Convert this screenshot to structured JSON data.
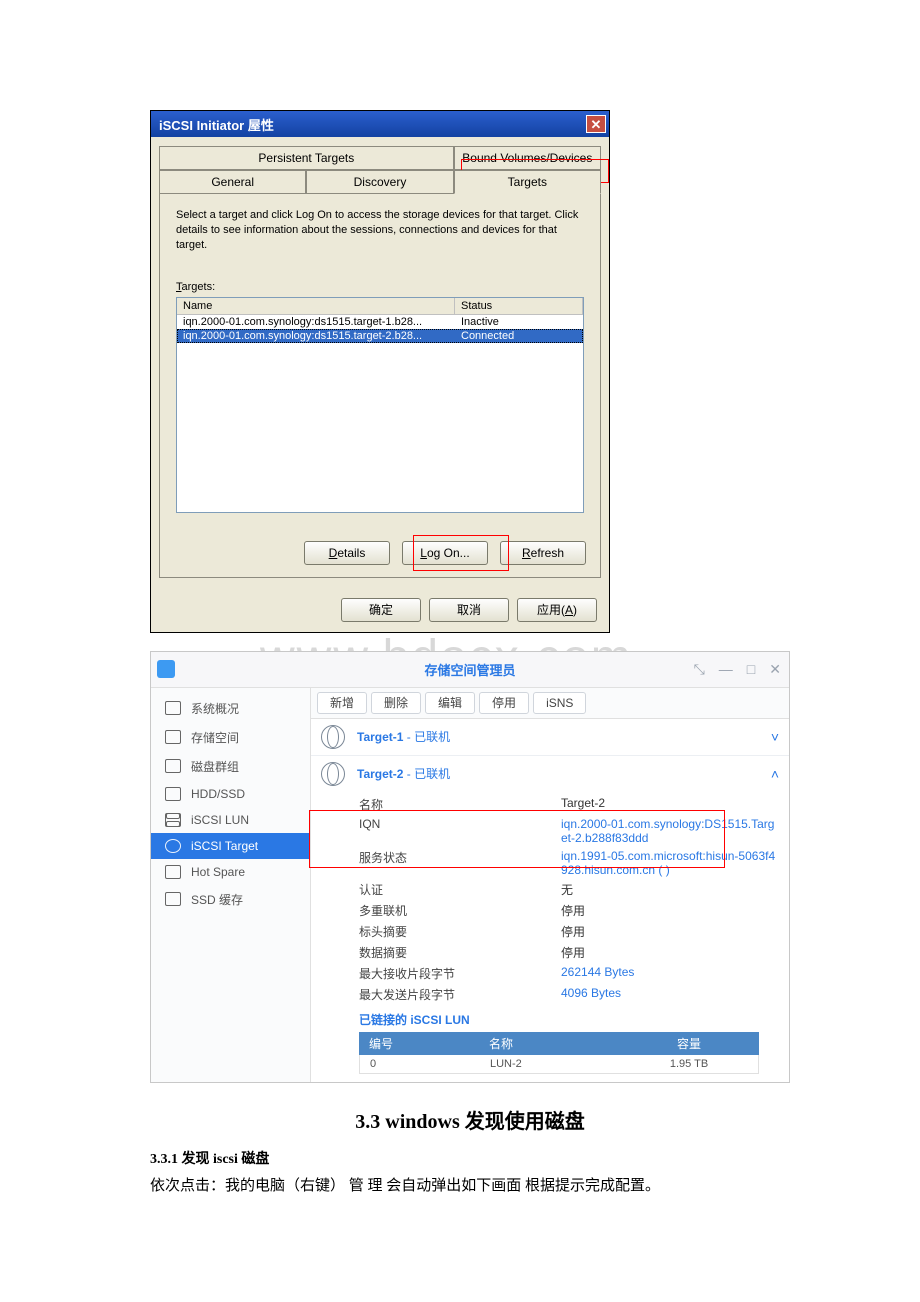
{
  "iscsi_dialog": {
    "title": "iSCSI Initiator 屋性",
    "close_glyph": "✕",
    "tabs_row1": [
      "Persistent Targets",
      "Bound Volumes/Devices"
    ],
    "tabs_row2": [
      "General",
      "Discovery",
      "Targets"
    ],
    "active_tab_index": 2,
    "intro": "Select a target and click Log On to access the storage devices for that target. Click details to see information about the sessions, connections and devices for that target.",
    "targets_label_prefix": "T",
    "targets_label_rest": "argets:",
    "columns": {
      "name": "Name",
      "status": "Status"
    },
    "rows": [
      {
        "name": "iqn.2000-01.com.synology:ds1515.target-1.b28...",
        "status": "Inactive",
        "selected": false
      },
      {
        "name": "iqn.2000-01.com.synology:ds1515.target-2.b28...",
        "status": "Connected",
        "selected": true
      }
    ],
    "btn_details": {
      "u": "D",
      "rest": "etails"
    },
    "btn_logon": {
      "u": "L",
      "rest": "og On..."
    },
    "btn_refresh": {
      "u": "R",
      "rest": "efresh"
    },
    "btn_ok": "确定",
    "btn_cancel": "取消",
    "btn_apply": {
      "text": "应用",
      "accel_open": "(",
      "accel_u": "A",
      "accel_close": ")"
    }
  },
  "watermark": "www.bdocx.com",
  "dsm": {
    "window_title": "存储空间管理员",
    "win_icons": {
      "pin": "⤡",
      "min": "—",
      "max": "□",
      "close": "✕"
    },
    "sidebar": [
      {
        "label": "系统概况",
        "icon": "overview"
      },
      {
        "label": "存储空间",
        "icon": "volume"
      },
      {
        "label": "磁盘群组",
        "icon": "group"
      },
      {
        "label": "HDD/SSD",
        "icon": "disk"
      },
      {
        "label": "iSCSI LUN",
        "icon": "db"
      },
      {
        "label": "iSCSI Target",
        "icon": "globe",
        "active": true
      },
      {
        "label": "Hot Spare",
        "icon": "spare"
      },
      {
        "label": "SSD 缓存",
        "icon": "cache"
      }
    ],
    "toolbar": [
      "新增",
      "删除",
      "编辑",
      "停用",
      "iSNS"
    ],
    "targets": [
      {
        "title": "Target-1",
        "status": "已联机",
        "expanded": false,
        "chev": "˅"
      },
      {
        "title": "Target-2",
        "status": "已联机",
        "expanded": true,
        "chev": "˄"
      }
    ],
    "detail": {
      "name_k": "名称",
      "name_v": "Target-2",
      "iqn_k": "IQN",
      "iqn_v": "iqn.2000-01.com.synology:DS1515.Target-2.b288f83ddd",
      "svc_k": "服务状态",
      "svc_v": "iqn.1991-05.com.microsoft:hisun-5063f4928.hisun.com.cn (               )",
      "auth_k": "认证",
      "auth_v": "无",
      "multi_k": "多重联机",
      "multi_v": "停用",
      "hdr_k": "标头摘要",
      "hdr_v": "停用",
      "datad_k": "数据摘要",
      "datad_v": "停用",
      "maxrx_k": "最大接收片段字节",
      "maxrx_v": "262144 Bytes",
      "maxtx_k": "最大发送片段字节",
      "maxtx_v": "4096 Bytes",
      "linked_header": "已链接的 iSCSI LUN",
      "table": {
        "cols": [
          "编号",
          "名称",
          "容量"
        ],
        "rows": [
          [
            "0",
            "LUN-2",
            "1.95 TB"
          ]
        ]
      }
    }
  },
  "doc": {
    "h2": "3.3 windows 发现使用磁盘",
    "h3": "3.3.1 发现 iscsi 磁盘",
    "p": "依次点击：我的电脑（右键） 管 理 会自动弹出如下画面 根据提示完成配置。"
  }
}
